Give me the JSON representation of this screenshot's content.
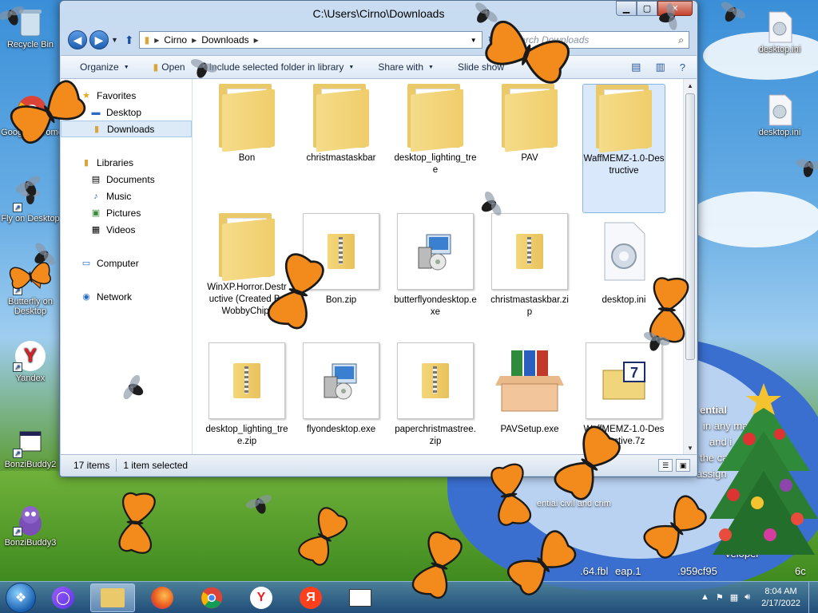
{
  "desktop": {
    "icons": [
      {
        "label": "Recycle Bin",
        "icon": "recycle-bin-icon"
      },
      {
        "label": "Google Chrome",
        "icon": "chrome-icon"
      },
      {
        "label": "Fly on Desktop",
        "icon": "fly-icon"
      },
      {
        "label": "Butterfly on Desktop",
        "icon": "butterfly-icon"
      },
      {
        "label": "Yandex",
        "icon": "yandex-icon"
      },
      {
        "label": "BonziBuddy2",
        "icon": "bonzi-icon"
      },
      {
        "label": "BonziBuddy3",
        "icon": "bonzi-icon"
      },
      {
        "label": "desktop.ini",
        "icon": "settings-file-icon"
      },
      {
        "label": "desktop.ini",
        "icon": "settings-file-icon"
      }
    ],
    "wallpaper_text": [
      "ential",
      "in any ma",
      "and i",
      "the ca",
      "assign",
      "ential civil and crim",
      "veloper",
      ".64.fbl",
      "eap.1",
      ".959cf95",
      "6c"
    ]
  },
  "window": {
    "title": "C:\\Users\\Cirno\\Downloads",
    "controls": {
      "minimize": "▁",
      "maximize": "▢",
      "close": "✕"
    },
    "address": {
      "crumbs": [
        "Cirno",
        "Downloads"
      ]
    },
    "search_placeholder": "Search Downloads",
    "toolbar": {
      "organize": "Organize",
      "open": "Open",
      "include": "Include selected folder in library",
      "share": "Share with",
      "slideshow": "Slide show"
    },
    "nav": {
      "favorites_header": "Favorites",
      "favorites": [
        "Desktop",
        "Downloads"
      ],
      "libraries_header": "Libraries",
      "libraries": [
        "Documents",
        "Music",
        "Pictures",
        "Videos"
      ],
      "computer": "Computer",
      "network": "Network"
    },
    "files": [
      {
        "name": "Bon",
        "type": "folder",
        "selected": false
      },
      {
        "name": "christmastaskbar",
        "type": "folder",
        "selected": false
      },
      {
        "name": "desktop_lighting_tree",
        "type": "folder",
        "selected": false
      },
      {
        "name": "PAV",
        "type": "folder",
        "selected": false
      },
      {
        "name": "WaffMEMZ-1.0-Destructive",
        "type": "folder",
        "selected": true
      },
      {
        "name": "WinXP.Horror.Destructive (Created By WobbyChip)",
        "type": "folder",
        "selected": false
      },
      {
        "name": "Bon.zip",
        "type": "zip",
        "selected": false
      },
      {
        "name": "butterflyondesktop.exe",
        "type": "exe",
        "selected": false
      },
      {
        "name": "christmastaskbar.zip",
        "type": "zip",
        "selected": false
      },
      {
        "name": "desktop.ini",
        "type": "ini",
        "selected": false
      },
      {
        "name": "desktop_lighting_tree.zip",
        "type": "zip",
        "selected": false
      },
      {
        "name": "flyondesktop.exe",
        "type": "exe",
        "selected": false
      },
      {
        "name": "paperchristmastree.zip",
        "type": "zip",
        "selected": false
      },
      {
        "name": "PAVSetup.exe",
        "type": "setup",
        "selected": false
      },
      {
        "name": "WaffMEMZ-1.0-Destructive.7z",
        "type": "7z",
        "selected": false
      },
      {
        "name": "",
        "type": "zip",
        "selected": false
      },
      {
        "name": "",
        "type": "yandex",
        "selected": false
      }
    ],
    "status": {
      "count": "17 items",
      "selection": "1 item selected"
    }
  },
  "taskbar": {
    "apps": [
      "start-orb",
      "alice",
      "explorer",
      "firefox",
      "chrome",
      "yandex-browser",
      "yandex",
      "window-app"
    ],
    "clock_time": "8:04 AM",
    "clock_date": "2/17/2022"
  }
}
